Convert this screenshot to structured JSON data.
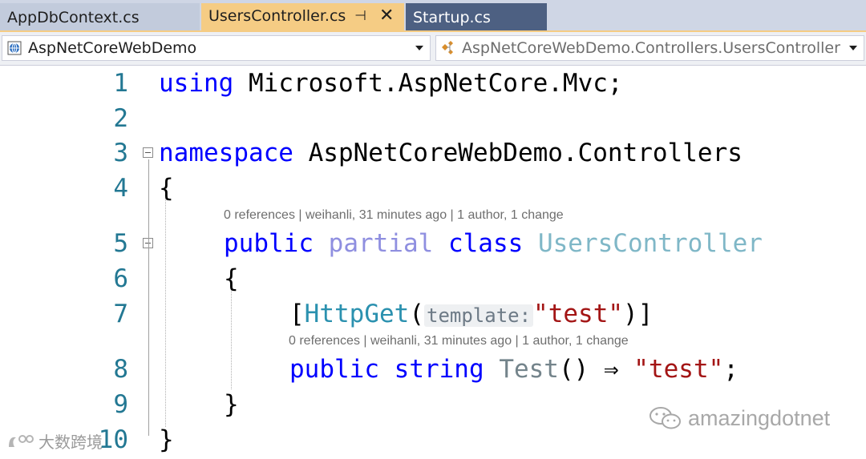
{
  "tabs": [
    {
      "label": "AppDbContext.cs"
    },
    {
      "label": "UsersController.cs",
      "pin": "⊣",
      "close": "✕"
    },
    {
      "label": "Startup.cs"
    }
  ],
  "navbar": {
    "project": "AspNetCoreWebDemo",
    "type_scope": "AspNetCoreWebDemo.Controllers.UsersController"
  },
  "code": {
    "line_numbers": [
      "1",
      "2",
      "3",
      "4",
      "5",
      "6",
      "7",
      "8",
      "9",
      "10"
    ],
    "l1": {
      "kw": "using",
      "rest": " Microsoft.AspNetCore.Mvc;"
    },
    "l3": {
      "kw": "namespace",
      "rest": " AspNetCoreWebDemo.Controllers"
    },
    "l4": {
      "text": "{"
    },
    "lens1": "0 references | weihanli, 31 minutes ago | 1 author, 1 change",
    "l5": {
      "kw1": "public",
      "kw2": "partial",
      "kw3": "class",
      "type": "UsersController"
    },
    "l6": {
      "text": "{"
    },
    "l7": {
      "open": "[",
      "attr": "HttpGet",
      "paren": "(",
      "hint": "template:",
      "str": "\"test\"",
      "close": ")]"
    },
    "lens2": "0 references | weihanli, 31 minutes ago | 1 author, 1 change",
    "l8": {
      "kw1": "public",
      "kw2": "string",
      "meth": "Test",
      "punct": "() ⇒ ",
      "str": "\"test\"",
      "end": ";"
    },
    "l9": {
      "text": "}"
    },
    "l10": {
      "text": "}"
    }
  },
  "watermarks": {
    "left": "大数跨境",
    "right": "amazingdotnet"
  }
}
